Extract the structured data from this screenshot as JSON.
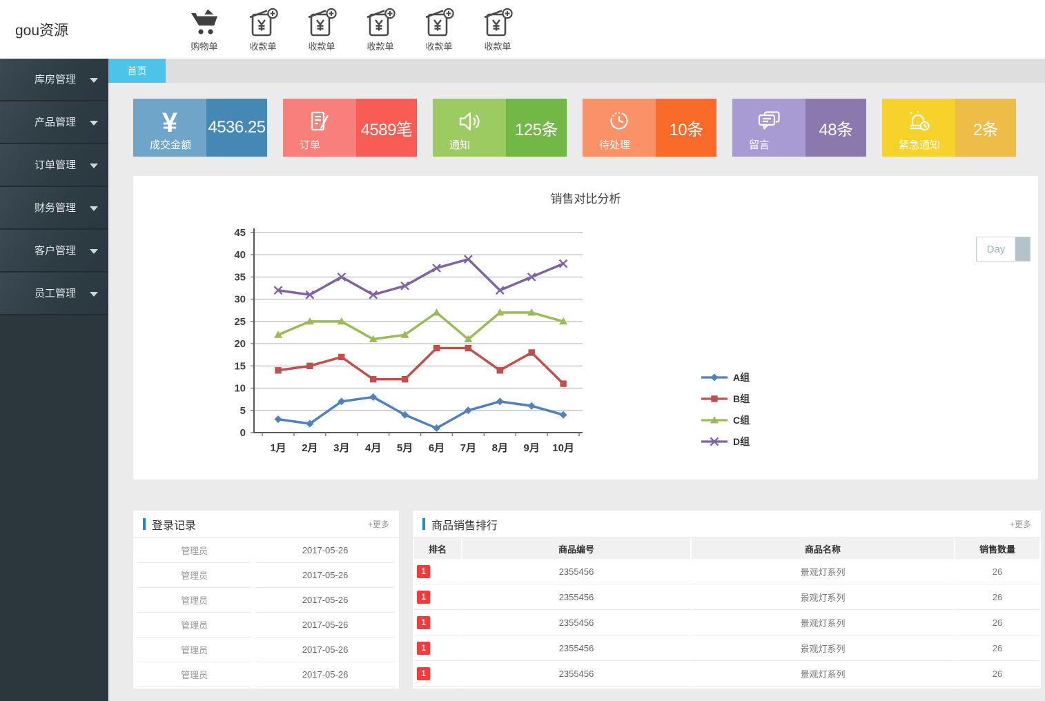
{
  "app": {
    "logo": "gou资源"
  },
  "header": {
    "actions": [
      {
        "label": "购物单",
        "icon": "cart-icon"
      },
      {
        "label": "收款单",
        "icon": "receipt-add-icon"
      },
      {
        "label": "收款单",
        "icon": "receipt-add-icon"
      },
      {
        "label": "收款单",
        "icon": "receipt-add-icon"
      },
      {
        "label": "收款单",
        "icon": "receipt-add-icon"
      },
      {
        "label": "收款单",
        "icon": "receipt-add-icon"
      }
    ]
  },
  "sidebar": {
    "items": [
      {
        "label": "库房管理"
      },
      {
        "label": "产品管理"
      },
      {
        "label": "订单管理"
      },
      {
        "label": "财务管理"
      },
      {
        "label": "客户管理"
      },
      {
        "label": "员工管理"
      }
    ]
  },
  "tabs": {
    "home": "首页"
  },
  "stats": {
    "cards": [
      {
        "label": "成交金额",
        "value": "4536.25",
        "icon": "yen-icon",
        "icon_glyph": "¥",
        "color_light": "#6fa5c8",
        "color_dark": "#4587b5"
      },
      {
        "label": "订单",
        "value": "4589笔",
        "icon": "order-icon",
        "color_light": "#f9807a",
        "color_dark": "#f95c55"
      },
      {
        "label": "通知",
        "value": "125条",
        "icon": "speaker-icon",
        "color_light": "#9bcb61",
        "color_dark": "#72b847"
      },
      {
        "label": "待处理",
        "value": "10条",
        "icon": "clock-icon",
        "color_light": "#fb9166",
        "color_dark": "#fa6a28"
      },
      {
        "label": "留言",
        "value": "48条",
        "icon": "chat-icon",
        "color_light": "#a89ad3",
        "color_dark": "#8979ac"
      },
      {
        "label": "紧急通知",
        "value": "2条",
        "icon": "siren-icon",
        "color_light": "#f6d22b",
        "color_dark": "#edbd45"
      }
    ]
  },
  "chart": {
    "title": "销售对比分析",
    "day_button": "Day"
  },
  "chart_data": {
    "type": "line",
    "title": "销售对比分析",
    "categories": [
      "1月",
      "2月",
      "3月",
      "4月",
      "5月",
      "6月",
      "7月",
      "8月",
      "9月",
      "10月"
    ],
    "series": [
      {
        "name": "A组",
        "color": "#4F81BD",
        "marker": "diamond",
        "values": [
          3,
          2,
          7,
          8,
          4,
          1,
          5,
          7,
          6,
          4
        ]
      },
      {
        "name": "B组",
        "color": "#C0504D",
        "marker": "square",
        "values": [
          14,
          15,
          17,
          12,
          12,
          19,
          19,
          14,
          18,
          11
        ]
      },
      {
        "name": "C组",
        "color": "#9BBB59",
        "marker": "triangle",
        "values": [
          22,
          25,
          25,
          21,
          22,
          27,
          21,
          27,
          27,
          25
        ]
      },
      {
        "name": "D组",
        "color": "#8064A2",
        "marker": "x",
        "values": [
          32,
          31,
          35,
          31,
          33,
          37,
          39,
          32,
          35,
          38
        ]
      }
    ],
    "ylim": [
      0,
      45
    ],
    "ystep": 5,
    "grid": true,
    "legend_position": "right"
  },
  "login_panel": {
    "title": "登录记录",
    "more": "+更多",
    "rows": [
      {
        "user": "管理员",
        "date": "2017-05-26"
      },
      {
        "user": "管理员",
        "date": "2017-05-26"
      },
      {
        "user": "管理员",
        "date": "2017-05-26"
      },
      {
        "user": "管理员",
        "date": "2017-05-26"
      },
      {
        "user": "管理员",
        "date": "2017-05-26"
      },
      {
        "user": "管理员",
        "date": "2017-05-26"
      }
    ]
  },
  "sales_panel": {
    "title": "商品销售排行",
    "more": "+更多",
    "columns": [
      "排名",
      "商品编号",
      "商品名称",
      "销售数量"
    ],
    "rows": [
      {
        "rank": "1",
        "code": "2355456",
        "name": "景观灯系列",
        "qty": "26"
      },
      {
        "rank": "1",
        "code": "2355456",
        "name": "景观灯系列",
        "qty": "26"
      },
      {
        "rank": "1",
        "code": "2355456",
        "name": "景观灯系列",
        "qty": "26"
      },
      {
        "rank": "1",
        "code": "2355456",
        "name": "景观灯系列",
        "qty": "26"
      },
      {
        "rank": "1",
        "code": "2355456",
        "name": "景观灯系列",
        "qty": "26"
      }
    ]
  },
  "colors": {
    "tab_active": "#4cc3e9",
    "panel_accent": "#1e8bd0",
    "rank_badge": "#f43b3b",
    "sidebar_bg": "#2b363d"
  }
}
